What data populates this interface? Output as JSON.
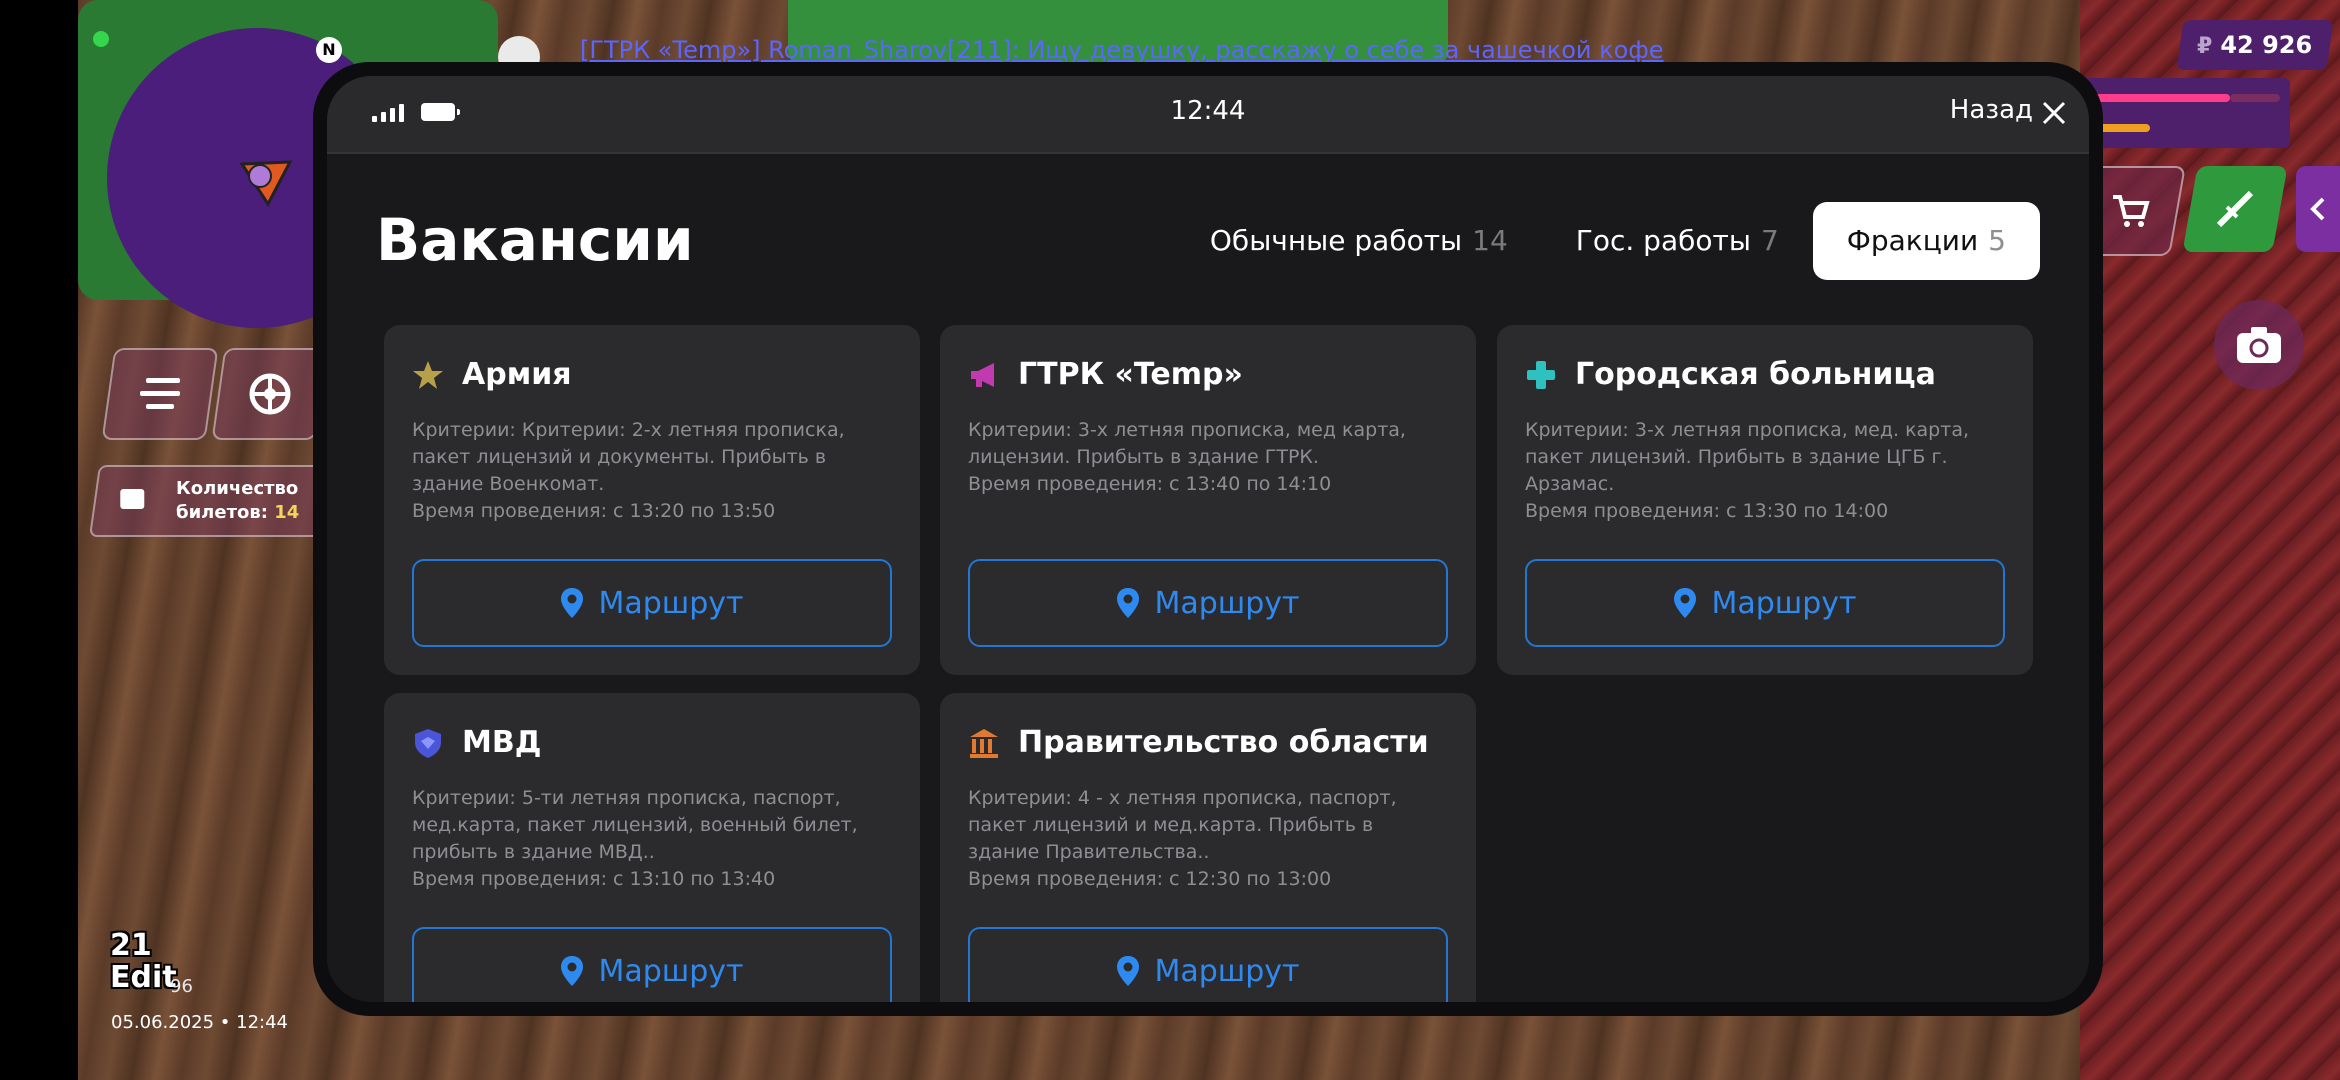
{
  "game_hud": {
    "chat_message": "[ГТРК «Temp»] Roman_Sharov[211]: Ищу девушку, расскажу о себе за чашечкой кофе",
    "minimap_north": "N",
    "money_symbol": "₽",
    "money": "42 926",
    "tickets_label_line1": "Количество",
    "tickets_label_line2": "билетов:",
    "tickets_count": "14",
    "date_time": "05.06.2025 • 12:44",
    "overlay_number": "21",
    "overlay_edit": "Edit",
    "overlay_sub": "96"
  },
  "phone": {
    "time": "12:44",
    "back_label": "Назад"
  },
  "page": {
    "title": "Вакансии"
  },
  "tabs": [
    {
      "label": "Обычные работы",
      "count": "14",
      "active": false
    },
    {
      "label": "Гос. работы",
      "count": "7",
      "active": false
    },
    {
      "label": "Фракции",
      "count": "5",
      "active": true
    }
  ],
  "cards": [
    {
      "title": "Армия",
      "icon": "star-icon",
      "icon_color": "#b8a04a",
      "criteria": "Критерии: Критерии: 2-х летняя прописка, пакет лицензий и документы. Прибыть в здание Военкомат.",
      "time": "Время проведения: с 13:20 по 13:50",
      "button": "Маршрут"
    },
    {
      "title": "ГТРК «Temp»",
      "icon": "megaphone-icon",
      "icon_color": "#c23ab0",
      "criteria": "Критерии: 3-х летняя прописка, мед карта, лицензии. Прибыть в здание ГТРК.",
      "time": "Время проведения: с 13:40 по 14:10",
      "button": "Маршрут"
    },
    {
      "title": "Городская больница",
      "icon": "medical-cross-icon",
      "icon_color": "#2fc0c0",
      "criteria": "Критерии: 3-х летняя прописка, мед. карта, пакет лицензий. Прибыть в здание ЦГБ г. Арзамас.",
      "time": "Время проведения: с 13:30 по 14:00",
      "button": "Маршрут"
    },
    {
      "title": "МВД",
      "icon": "police-shield-icon",
      "icon_color": "#4a55d8",
      "criteria": "Критерии: 5-ти летняя прописка, паспорт, мед.карта, пакет лицензий, военный билет, прибыть в здание МВД..",
      "time": "Время проведения: с 13:10 по 13:40",
      "button": "Маршрут"
    },
    {
      "title": "Правительство области",
      "icon": "government-building-icon",
      "icon_color": "#e07a30",
      "criteria": "Критерии: 4 - х летняя прописка, паспорт, пакет лицензий и мед.карта. Прибыть в здание Правительства..",
      "time": "Время проведения: с 12:30 по 13:00",
      "button": "Маршрут"
    }
  ],
  "colors": {
    "accent_blue": "#2f8af0",
    "card_bg": "#2b2b2e",
    "screen_bg": "#19191b"
  }
}
